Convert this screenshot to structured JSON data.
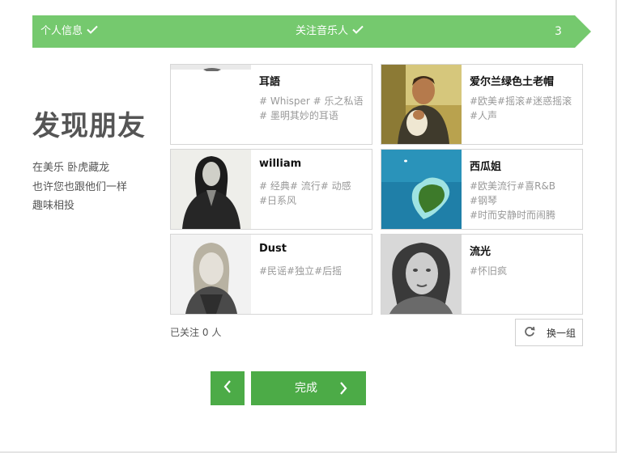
{
  "progress": {
    "steps": [
      {
        "label": "个人信息",
        "done": true
      },
      {
        "label": "关注音乐人",
        "done": true
      },
      {
        "label": "3",
        "done": false
      }
    ],
    "color": "#75c96e"
  },
  "intro": {
    "title": "发现朋友",
    "lines": [
      "在美乐 卧虎藏龙",
      "也许您也跟他们一样",
      "趣味相投"
    ]
  },
  "users": [
    {
      "name": "耳語",
      "tags": [
        "# Whisper # 乐之私语",
        "# 墨明其妙的耳语"
      ]
    },
    {
      "name": "爱尔兰绿色土老帽",
      "tags": [
        "#欧美#摇滚#迷惑摇滚",
        "#人声"
      ]
    },
    {
      "name": "william",
      "tags": [
        "# 经典# 流行# 动感",
        "#日系风"
      ]
    },
    {
      "name": "西瓜姐",
      "tags": [
        "#欧美流行#喜R&B",
        "#钢琴",
        "#时而安静时而闹腾"
      ]
    },
    {
      "name": "Dust",
      "tags": [
        "#民谣#独立#后摇"
      ]
    },
    {
      "name": "流光",
      "tags": [
        "#怀旧疯"
      ]
    }
  ],
  "footer": {
    "followed_prefix": "已关注",
    "followed_count": "0",
    "followed_suffix": "人",
    "refresh_label": "换一组",
    "done_label": "完成"
  },
  "icons": {
    "check": "check-icon",
    "refresh": "refresh-icon",
    "prev": "chevron-left-icon",
    "next": "chevron-right-icon"
  },
  "accent_color": "#4cab47"
}
